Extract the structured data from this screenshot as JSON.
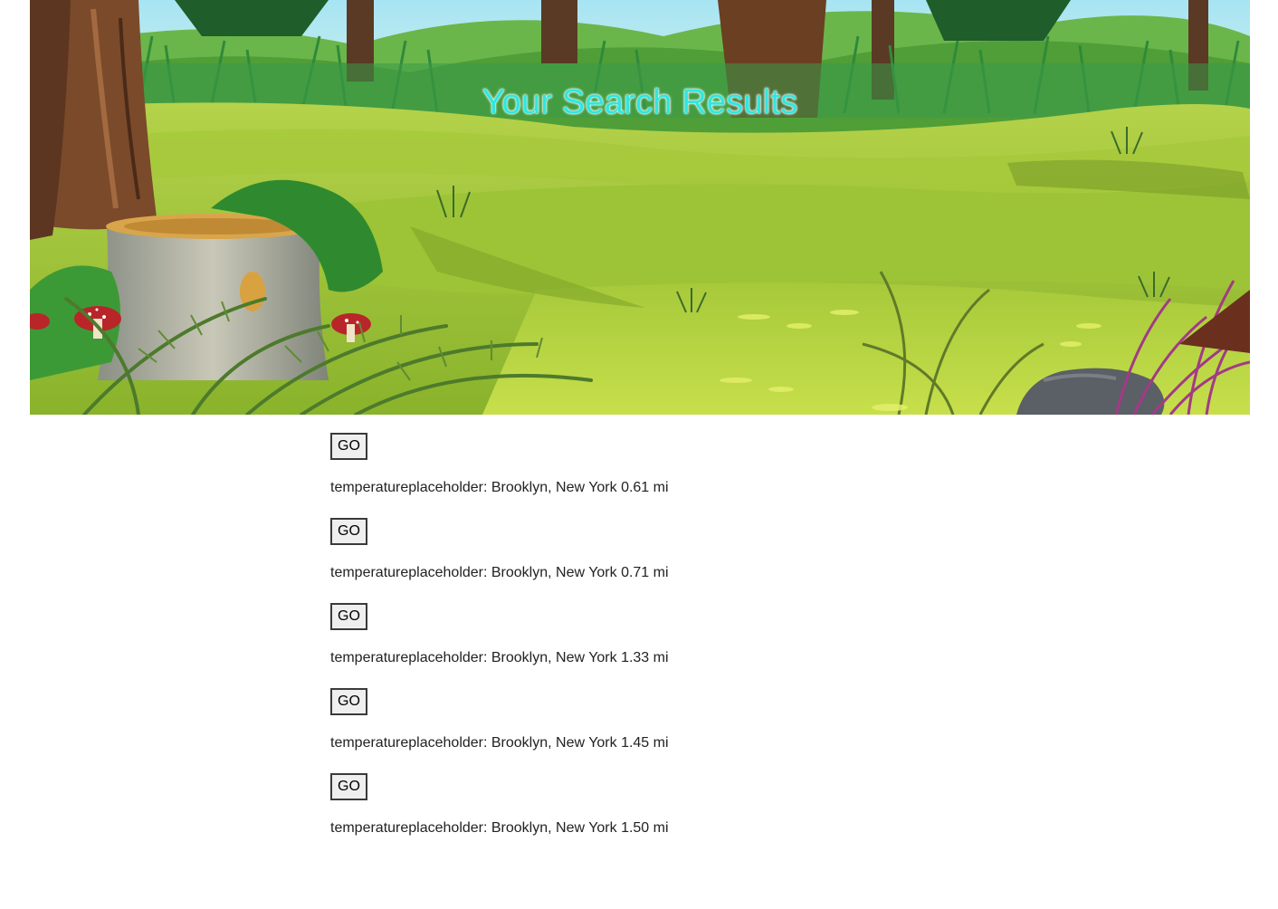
{
  "header": {
    "title": "Your Search Results"
  },
  "button_label": "GO",
  "results": [
    {
      "text": "temperatureplaceholder: Brooklyn, New York 0.61 mi"
    },
    {
      "text": "temperatureplaceholder: Brooklyn, New York 0.71 mi"
    },
    {
      "text": "temperatureplaceholder: Brooklyn, New York 1.33 mi"
    },
    {
      "text": "temperatureplaceholder: Brooklyn, New York 1.45 mi"
    },
    {
      "text": "temperatureplaceholder: Brooklyn, New York 1.50 mi"
    }
  ],
  "colors": {
    "title": "#2fe6e0",
    "sky": "#9fe0ef",
    "meadow": "#9cc53a",
    "forest": "#3f8a2c"
  }
}
